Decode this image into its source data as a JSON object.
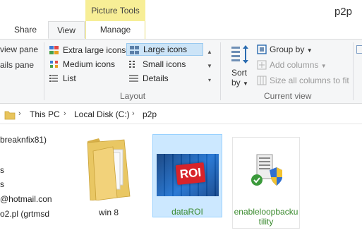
{
  "window": {
    "title": "p2p",
    "context_tab": "Picture Tools"
  },
  "tabs": [
    {
      "label": "Share"
    },
    {
      "label": "View"
    },
    {
      "label": "Manage"
    }
  ],
  "ribbon": {
    "panes": {
      "preview_pane": "view pane",
      "details_pane": "ails pane"
    },
    "layout": {
      "group_label": "Layout",
      "options": [
        {
          "label": "Extra large icons"
        },
        {
          "label": "Large icons",
          "selected": true
        },
        {
          "label": "Medium icons"
        },
        {
          "label": "Small icons"
        },
        {
          "label": "List"
        },
        {
          "label": "Details"
        }
      ]
    },
    "current_view": {
      "group_label": "Current view",
      "sort_by_line1": "Sort",
      "sort_by_line2": "by",
      "group_by": "Group by",
      "add_columns": "Add columns",
      "size_columns": "Size all columns to fit"
    }
  },
  "address": {
    "crumbs": [
      "This PC",
      "Local Disk (C:)",
      "p2p"
    ]
  },
  "nav": {
    "items": [
      "breaknfix81)",
      "s",
      "s",
      "@hotmail.con",
      "o2.pl (grtmsd"
    ]
  },
  "files": [
    {
      "name": "win 8",
      "type": "folder"
    },
    {
      "name": "dataROI",
      "type": "image",
      "selected": true,
      "thumb_text": "ROI"
    },
    {
      "name_line1": "enableloopbacku",
      "name_line2": "tility",
      "type": "exe"
    }
  ]
}
